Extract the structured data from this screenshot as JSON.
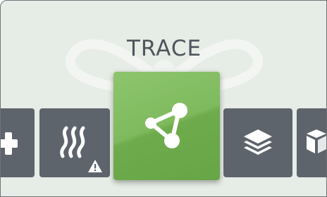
{
  "screen": {
    "title": "TRACE"
  },
  "tiles": [
    {
      "name": "add",
      "icon": "plus-icon",
      "active": false
    },
    {
      "name": "heat",
      "icon": "heat-waves-icon",
      "badge_icon": "warning-triangle-icon",
      "active": false
    },
    {
      "name": "trace",
      "icon": "share-nodes-icon",
      "active": true
    },
    {
      "name": "layers",
      "icon": "layers-icon",
      "active": false
    },
    {
      "name": "cube",
      "icon": "cube-icon",
      "active": false
    }
  ],
  "colors": {
    "background": "#e6ece6",
    "tile": "#5d646c",
    "active_tile": "#7ab659",
    "title": "#4e555c",
    "icon": "#ffffff"
  }
}
